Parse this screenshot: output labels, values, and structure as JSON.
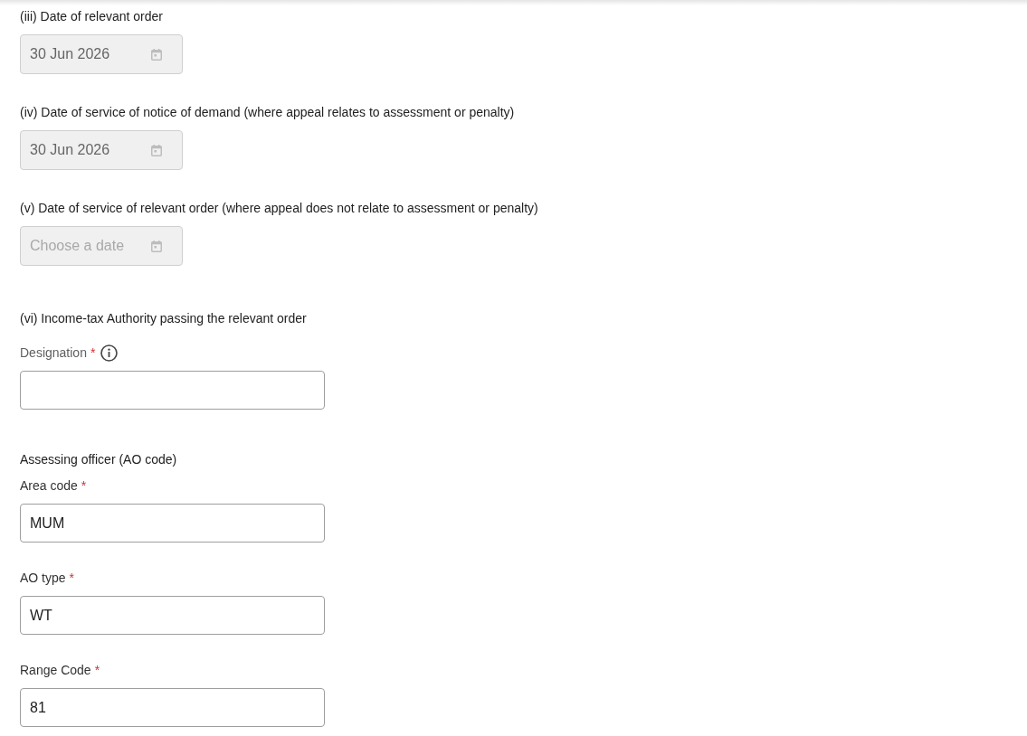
{
  "date_fields": [
    {
      "label": "(iii) Date of relevant order",
      "value": "30 Jun 2026",
      "disabled": true
    },
    {
      "label": "(iv) Date of service of notice of demand (where appeal relates to assessment or penalty)",
      "value": "30 Jun 2026",
      "disabled": true
    },
    {
      "label": "(v) Date of service of relevant order (where appeal does not relate to assessment or penalty)",
      "placeholder": "Choose a date",
      "disabled": true
    }
  ],
  "authority": {
    "heading": "(vi) Income-tax Authority passing the relevant order",
    "designation": {
      "label": "Designation",
      "required_mark": "*"
    }
  },
  "assessing_officer": {
    "heading": "Assessing officer (AO code)",
    "fields": [
      {
        "label": "Area code",
        "required_mark": "*",
        "value": "MUM"
      },
      {
        "label": "AO type",
        "required_mark": "*",
        "value": "WT"
      },
      {
        "label": "Range Code",
        "required_mark": "*",
        "value": "81"
      }
    ]
  }
}
